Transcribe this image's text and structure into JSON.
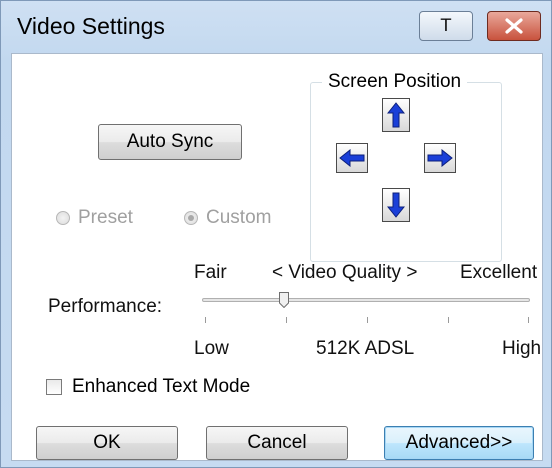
{
  "window": {
    "title": "Video Settings",
    "help_label": "T"
  },
  "auto_sync_label": "Auto Sync",
  "screen_position": {
    "label": "Screen Position",
    "arrows": [
      "up-arrow-icon",
      "left-arrow-icon",
      "right-arrow-icon",
      "down-arrow-icon"
    ]
  },
  "mode": {
    "preset_label": "Preset",
    "custom_label": "Custom",
    "selected": "Custom",
    "enabled": false
  },
  "quality": {
    "top_left": "Fair",
    "top_center": "< Video Quality >",
    "top_right": "Excellent",
    "performance_label": "Performance:",
    "bottom_left": "Low",
    "bottom_center": "512K ADSL",
    "bottom_right": "High",
    "slider_position": 0.27
  },
  "enhanced_text_mode": {
    "label": "Enhanced Text Mode",
    "checked": false
  },
  "buttons": {
    "ok": "OK",
    "cancel": "Cancel",
    "advanced": "Advanced>>"
  },
  "colors": {
    "title_bar": "#c6dbf1",
    "arrow_fill": "#1a3fd8",
    "close_button": "#c8523d"
  }
}
